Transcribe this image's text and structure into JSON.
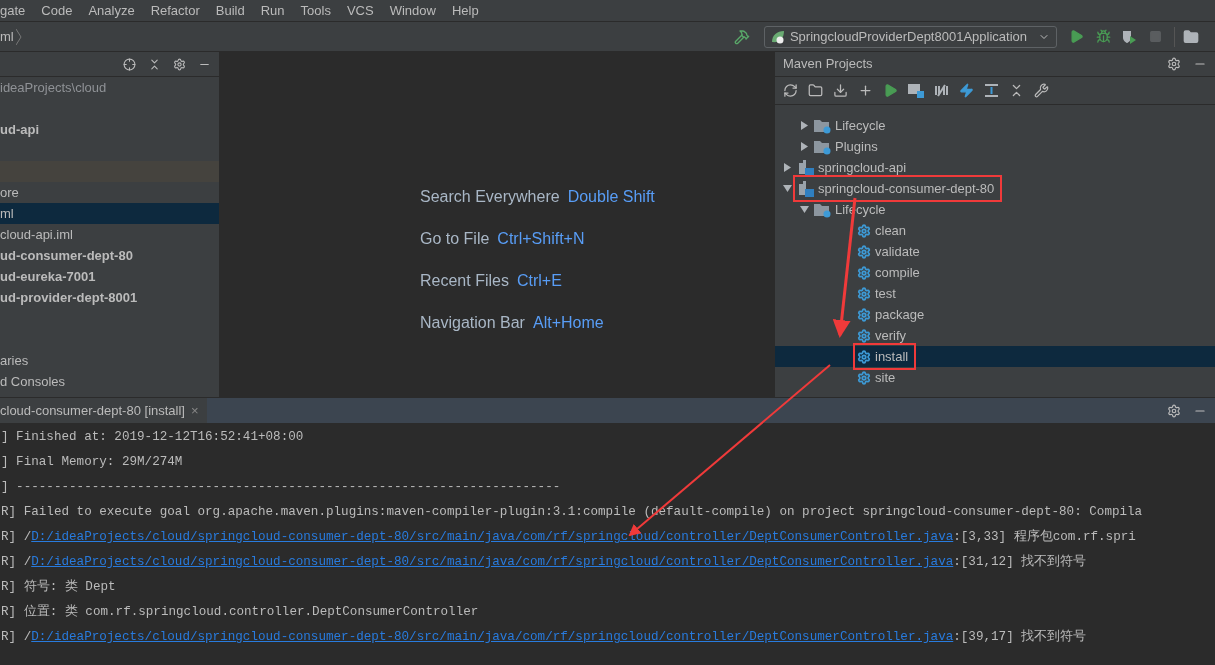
{
  "menu_bar": [
    "gate",
    "Code",
    "Analyze",
    "Refactor",
    "Build",
    "Run",
    "Tools",
    "VCS",
    "Window",
    "Help"
  ],
  "breadcrumb": "ml",
  "run_config": "SpringcloudProviderDept8001Application",
  "project_panel": {
    "items": [
      {
        "kind": "path",
        "text": "ideaProjects\\cloud",
        "selected": false
      },
      {
        "kind": "gap"
      },
      {
        "kind": "bold",
        "text": "ud-api",
        "selected": false
      },
      {
        "kind": "gap"
      },
      {
        "kind": "marked",
        "selected": false
      },
      {
        "kind": "plain",
        "text": "ore",
        "selected": false
      },
      {
        "kind": "plain",
        "text": "ml",
        "selected": true
      },
      {
        "kind": "plain",
        "text": "cloud-api.iml",
        "selected": false
      },
      {
        "kind": "bold",
        "text": "ud-consumer-dept-80",
        "selected": false
      },
      {
        "kind": "bold",
        "text": "ud-eureka-7001",
        "selected": false
      },
      {
        "kind": "bold",
        "text": "ud-provider-dept-8001",
        "selected": false
      },
      {
        "kind": "gap"
      },
      {
        "kind": "gap"
      },
      {
        "kind": "plain",
        "text": "aries",
        "selected": false
      },
      {
        "kind": "plain",
        "text": "d Consoles",
        "selected": false
      }
    ]
  },
  "editor_hints": [
    {
      "label": "Search Everywhere",
      "shortcut": "Double Shift"
    },
    {
      "label": "Go to File",
      "shortcut": "Ctrl+Shift+N"
    },
    {
      "label": "Recent Files",
      "shortcut": "Ctrl+E"
    },
    {
      "label": "Navigation Bar",
      "shortcut": "Alt+Home"
    }
  ],
  "maven_panel": {
    "title": "Maven Projects",
    "scrolled_group": [
      {
        "label": "Lifecycle",
        "kind": "folder",
        "expanded": false,
        "selected": false,
        "annotated": false
      },
      {
        "label": "Plugins",
        "kind": "folder",
        "expanded": false,
        "selected": false,
        "annotated": false
      }
    ],
    "tree": [
      {
        "label": "springcloud-api",
        "kind": "module",
        "expanded": false,
        "selected": false,
        "annotated": false
      },
      {
        "label": "springcloud-consumer-dept-80",
        "kind": "module",
        "expanded": true,
        "selected": false,
        "annotated": true,
        "children": [
          {
            "label": "Lifecycle",
            "kind": "folder",
            "expanded": true,
            "selected": false,
            "annotated": false,
            "children": [
              {
                "label": "clean",
                "kind": "goal",
                "selected": false,
                "annotated": false
              },
              {
                "label": "validate",
                "kind": "goal",
                "selected": false,
                "annotated": false
              },
              {
                "label": "compile",
                "kind": "goal",
                "selected": false,
                "annotated": false
              },
              {
                "label": "test",
                "kind": "goal",
                "selected": false,
                "annotated": false
              },
              {
                "label": "package",
                "kind": "goal",
                "selected": false,
                "annotated": false
              },
              {
                "label": "verify",
                "kind": "goal",
                "selected": false,
                "annotated": false
              },
              {
                "label": "install",
                "kind": "goal",
                "selected": true,
                "annotated": true
              },
              {
                "label": "site",
                "kind": "goal",
                "selected": false,
                "annotated": false
              }
            ]
          }
        ]
      }
    ]
  },
  "console": {
    "tab": "cloud-consumer-dept-80 [install]",
    "tab_close": "×",
    "lines": [
      [
        {
          "kind": "plain",
          "text": "] Finished at: 2019-12-12T16:52:41+08:00"
        }
      ],
      [
        {
          "kind": "plain",
          "text": "] Final Memory: 29M/274M"
        }
      ],
      [
        {
          "kind": "plain",
          "text": "] ------------------------------------------------------------------------"
        }
      ],
      [
        {
          "kind": "plain",
          "text": "R] Failed to execute goal org.apache.maven.plugins:maven-compiler-plugin:3.1:compile (default-compile) on project springcloud-consumer-dept-80: Compila"
        }
      ],
      [
        {
          "kind": "plain",
          "text": "R] /"
        },
        {
          "kind": "link",
          "text": "D:/ideaProjects/cloud/springcloud-consumer-dept-80/src/main/java/com/rf/springcloud/controller/DeptConsumerController.java"
        },
        {
          "kind": "plain",
          "text": ":[3,33] 程序包com.rf.spri"
        }
      ],
      [
        {
          "kind": "plain",
          "text": "R] /"
        },
        {
          "kind": "link",
          "text": "D:/ideaProjects/cloud/springcloud-consumer-dept-80/src/main/java/com/rf/springcloud/controller/DeptConsumerController.java"
        },
        {
          "kind": "plain",
          "text": ":[31,12] 找不到符号"
        }
      ],
      [
        {
          "kind": "plain",
          "text": "R] 符号:   类 Dept"
        }
      ],
      [
        {
          "kind": "plain",
          "text": "R] 位置: 类 com.rf.springcloud.controller.DeptConsumerController"
        }
      ],
      [
        {
          "kind": "plain",
          "text": "R] /"
        },
        {
          "kind": "link",
          "text": "D:/ideaProjects/cloud/springcloud-consumer-dept-80/src/main/java/com/rf/springcloud/controller/DeptConsumerController.java"
        },
        {
          "kind": "plain",
          "text": ":[39,17] 找不到符号"
        }
      ]
    ]
  }
}
